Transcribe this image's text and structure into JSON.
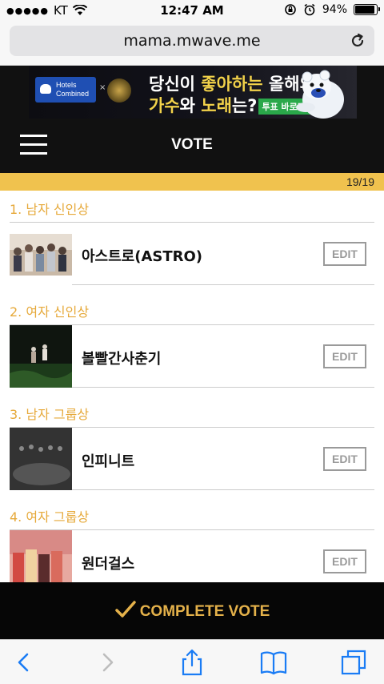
{
  "status_bar": {
    "carrier": "KT",
    "time": "12:47 AM",
    "battery": "94%",
    "battery_level": 0.94
  },
  "browser": {
    "url": "mama.mwave.me"
  },
  "ad": {
    "partner_logo": "Hotels Combined",
    "line1_a": "당신이 ",
    "line1_hl": "좋아하는",
    "line1_b": " 올해의",
    "line2_hl1": "가수",
    "line2_a": "와 ",
    "line2_hl2": "노래",
    "line2_b": "는?",
    "cta": "투표 바로가기!"
  },
  "header": {
    "title": "VOTE"
  },
  "progress": {
    "label": "19/19",
    "fraction": 1.0
  },
  "categories": [
    {
      "title": "1.  남자 신인상",
      "nominee": "아스트로(ASTRO)",
      "edit_label": "EDIT"
    },
    {
      "title": "2.  여자 신인상",
      "nominee": "볼빨간사춘기",
      "edit_label": "EDIT"
    },
    {
      "title": "3.  남자 그룹상",
      "nominee": "인피니트",
      "edit_label": "EDIT"
    },
    {
      "title": "4.  여자 그룹상",
      "nominee": "원더걸스",
      "edit_label": "EDIT"
    }
  ],
  "complete": {
    "label": "COMPLETE VOTE"
  },
  "colors": {
    "accent": "#e6a93a",
    "progress": "#f0c24e",
    "header_bg": "#111111"
  },
  "toolbar_icons": [
    "back-icon",
    "forward-icon",
    "share-icon",
    "bookmarks-icon",
    "tabs-icon"
  ]
}
